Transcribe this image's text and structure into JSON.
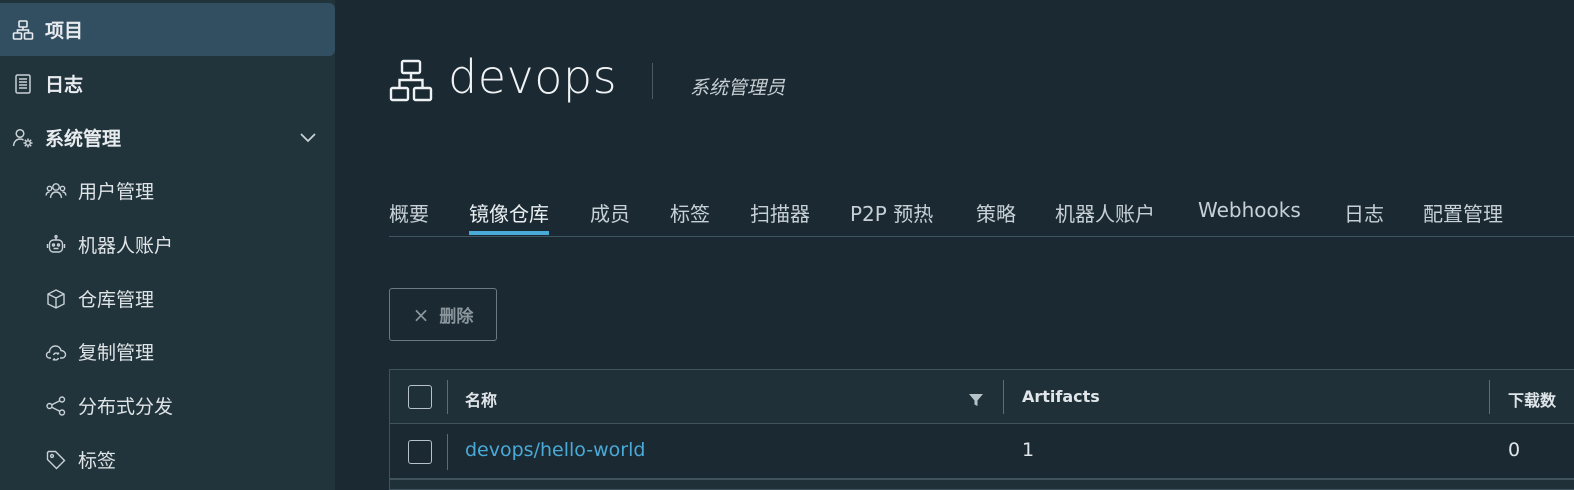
{
  "sidebar": {
    "items": [
      {
        "label": "项目",
        "icon": "projects-icon",
        "active": true
      },
      {
        "label": "日志",
        "icon": "logs-icon"
      },
      {
        "label": "系统管理",
        "icon": "admin-icon"
      }
    ],
    "sub_items": [
      {
        "label": "用户管理",
        "icon": "users-icon"
      },
      {
        "label": "机器人账户",
        "icon": "robot-icon"
      },
      {
        "label": "仓库管理",
        "icon": "box-icon"
      },
      {
        "label": "复制管理",
        "icon": "cloud-sync-icon"
      },
      {
        "label": "分布式分发",
        "icon": "share-icon"
      },
      {
        "label": "标签",
        "icon": "tag-icon"
      }
    ]
  },
  "header": {
    "title": "devops",
    "role": "系统管理员"
  },
  "tabs": [
    "概要",
    "镜像仓库",
    "成员",
    "标签",
    "扫描器",
    "P2P 预热",
    "策略",
    "机器人账户",
    "Webhooks",
    "日志",
    "配置管理"
  ],
  "active_tab": "镜像仓库",
  "toolbar": {
    "delete_label": "删除",
    "delete_icon": "×"
  },
  "table": {
    "columns": [
      "名称",
      "Artifacts",
      "下载数"
    ],
    "rows": [
      {
        "name": "devops/hello-world",
        "artifacts": "1",
        "pulls": "0"
      }
    ]
  },
  "colors": {
    "accent": "#49a9d7",
    "active_nav": "#324f61",
    "sidebar_bg": "#21333b",
    "page_bg": "#1b2a32"
  }
}
